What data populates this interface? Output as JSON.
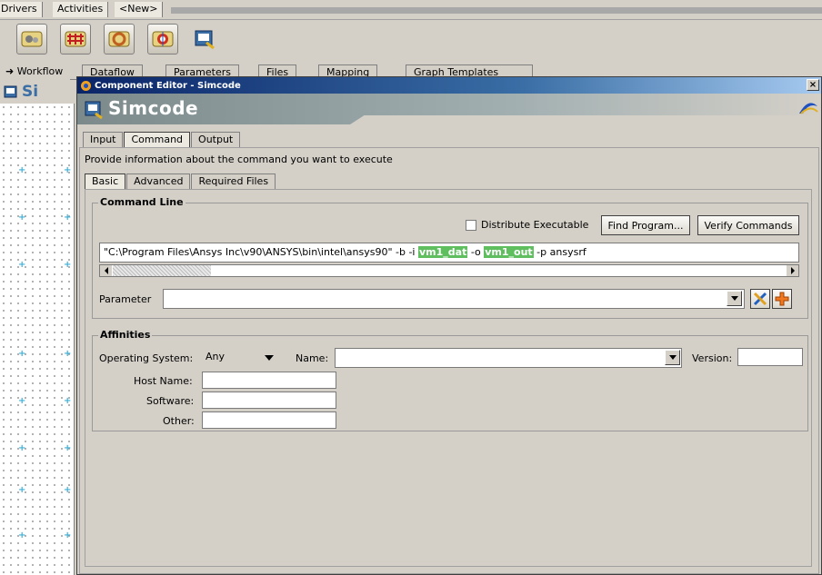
{
  "menubar": {
    "items": [
      "Drivers",
      "Activities",
      "<New>"
    ]
  },
  "toolbar": {
    "icons": [
      "gears-icon",
      "grid-icon",
      "ring-icon",
      "target-icon",
      "simcode-icon"
    ]
  },
  "workflow_tabs": {
    "items": [
      "Workflow",
      "Dataflow",
      "Parameters",
      "Files",
      "Mapping",
      "Graph Templates"
    ]
  },
  "left_panel": {
    "title": "Si"
  },
  "dialog": {
    "window_title": "Component Editor - Simcode",
    "close_label": "×",
    "banner_title": "Simcode",
    "main_tabs": [
      "Input",
      "Command",
      "Output"
    ],
    "active_main_tab": "Command",
    "instruction": "Provide information about the command you want to execute",
    "sub_tabs": [
      "Basic",
      "Advanced",
      "Required Files"
    ],
    "active_sub_tab": "Basic",
    "command_line": {
      "group_label": "Command Line",
      "distribute_label": "Distribute Executable",
      "distribute_checked": false,
      "find_button": "Find Program...",
      "verify_button": "Verify Commands",
      "cmd_prefix": "\"C:\\Program Files\\Ansys Inc\\v90\\ANSYS\\bin\\intel\\ansys90\" -b -i ",
      "cmd_var1": "vm1_dat",
      "cmd_mid": " -o ",
      "cmd_var2": "vm1_out",
      "cmd_suffix": " -p ansysrf",
      "highlight_color": "#5fbf5f"
    },
    "parameter": {
      "label": "Parameter",
      "value": ""
    },
    "affinities": {
      "group_label": "Affinities",
      "os_label": "Operating System:",
      "os_value": "Any",
      "name_label": "Name:",
      "name_value": "",
      "version_label": "Version:",
      "version_value": "",
      "host_label": "Host Name:",
      "host_value": "",
      "software_label": "Software:",
      "software_value": "",
      "other_label": "Other:",
      "other_value": ""
    }
  }
}
